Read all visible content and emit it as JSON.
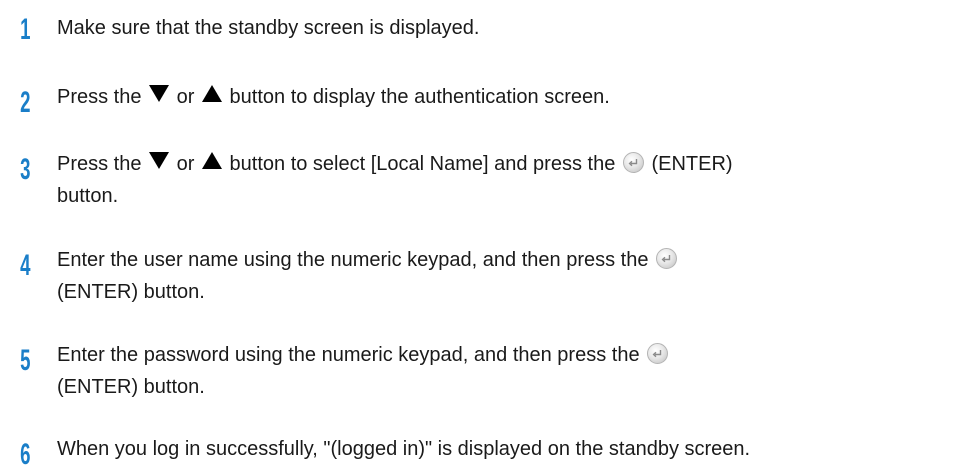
{
  "steps": [
    {
      "number": "1",
      "parts": [
        "Make sure that the standby screen is displayed."
      ]
    },
    {
      "number": "2",
      "parts": [
        "Press the",
        "or",
        "button to display the authentication screen."
      ]
    },
    {
      "number": "3",
      "parts": [
        "Press the",
        "or",
        "button to select [Local Name] and press the",
        "(ENTER)",
        "button."
      ]
    },
    {
      "number": "4",
      "parts": [
        "Enter the user name using the numeric keypad, and then press the",
        "(ENTER) button."
      ]
    },
    {
      "number": "5",
      "parts": [
        "Enter the password using the numeric keypad, and then press the",
        "(ENTER) button."
      ]
    },
    {
      "number": "6",
      "parts": [
        "When you log in successfully, \"(logged in)\" is displayed on the standby screen."
      ]
    }
  ],
  "icons": {
    "down": "down-triangle-icon",
    "up": "up-triangle-icon",
    "enter": "enter-button-icon"
  },
  "colors": {
    "step_number": "#1a7ec8",
    "text": "#1a1a1a"
  }
}
